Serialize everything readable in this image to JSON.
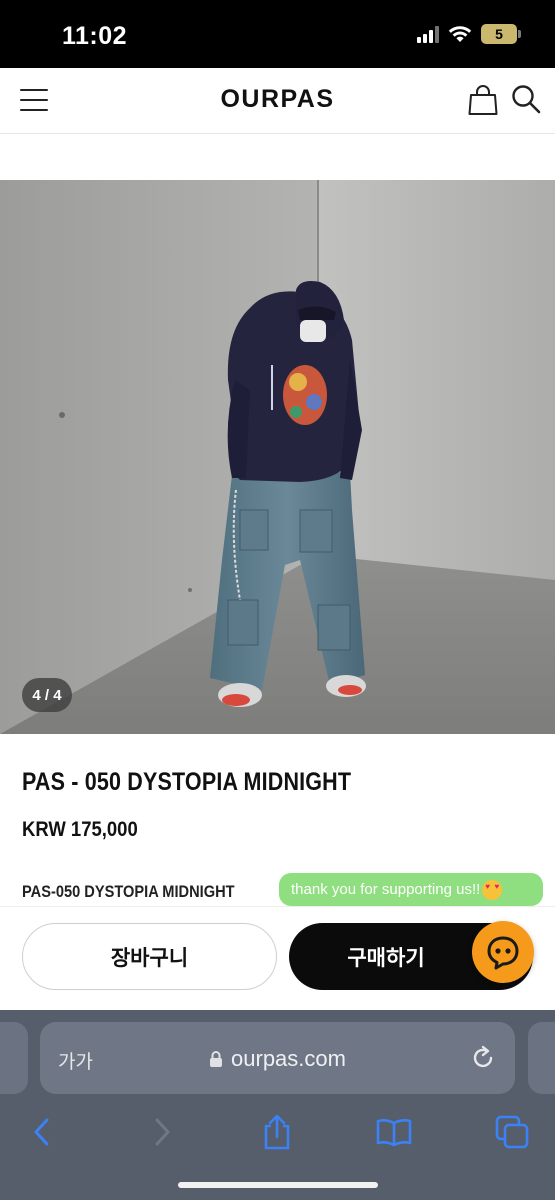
{
  "status_bar": {
    "time": "11:02",
    "battery": "5"
  },
  "header": {
    "logo": "OURPAS"
  },
  "product": {
    "image_counter": "4 / 4",
    "title": "PAS - 050 DYSTOPIA MIDNIGHT",
    "price": "KRW 175,000",
    "subname": "PAS-050 DYSTOPIA MIDNIGHT"
  },
  "chat": {
    "bubble_text": "thank you for supporting us!!"
  },
  "actions": {
    "cart_label": "장바구니",
    "buy_label": "구매하기"
  },
  "browser": {
    "aa_label": "가가",
    "url": "ourpas.com"
  },
  "colors": {
    "buy_button": "#0b0b0b",
    "chat_fab": "#f59a1b",
    "chat_bubble": "#8fde7f",
    "safari_chrome": "#565d6b",
    "safari_icon": "#3a82f6"
  }
}
